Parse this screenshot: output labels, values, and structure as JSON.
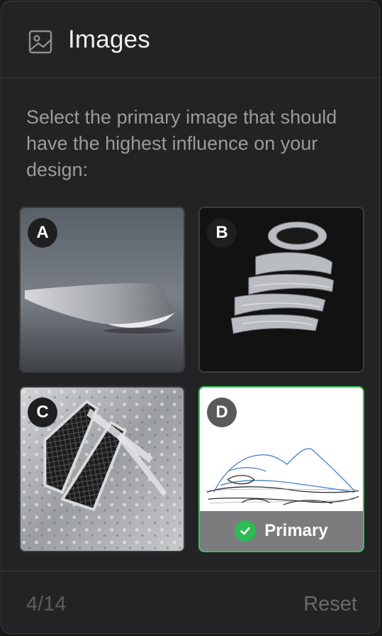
{
  "header": {
    "title": "Images",
    "icon": "image-icon"
  },
  "instruction": "Select the primary image that should have the highest influence on your design:",
  "images": [
    {
      "letter": "A",
      "subject": "sleek metallic object",
      "selected": false
    },
    {
      "letter": "B",
      "subject": "sculptural metallic shoe",
      "selected": false
    },
    {
      "letter": "C",
      "subject": "car vents with water droplets",
      "selected": false
    },
    {
      "letter": "D",
      "subject": "shoe sketch",
      "selected": true
    }
  ],
  "primary_label": "Primary",
  "footer": {
    "counter": "4/14",
    "reset_label": "Reset"
  },
  "colors": {
    "accent": "#2dbb55",
    "panel": "#232325",
    "border": "#3a3a3c"
  }
}
